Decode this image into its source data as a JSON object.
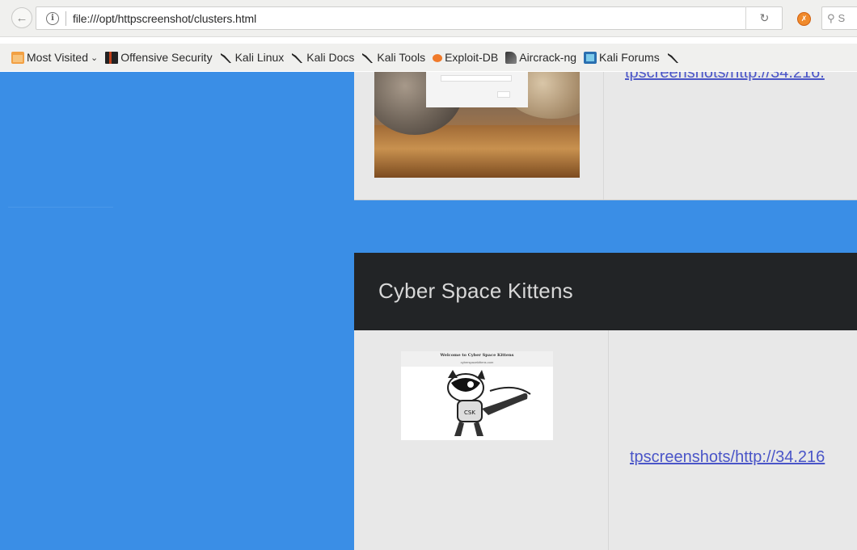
{
  "browser": {
    "url": "file:///opt/httpscreenshot/clusters.html",
    "search_placeholder": "S",
    "bookmarks": [
      {
        "label": "Most Visited",
        "icon": "folder-icon"
      },
      {
        "label": "Offensive Security",
        "icon": "offsec-icon"
      },
      {
        "label": "Kali Linux",
        "icon": "kali-dragon-icon"
      },
      {
        "label": "Kali Docs",
        "icon": "kali-dragon-icon"
      },
      {
        "label": "Kali Tools",
        "icon": "kali-dragon-icon"
      },
      {
        "label": "Exploit-DB",
        "icon": "exploit-db-icon"
      },
      {
        "label": "Aircrack-ng",
        "icon": "aircrack-icon"
      },
      {
        "label": "Kali Forums",
        "icon": "forums-icon"
      }
    ]
  },
  "cluster_1": {
    "link_text": "tpscreenshots/http://34.216."
  },
  "cluster_2": {
    "title": "Cyber Space Kittens",
    "screenshot_title": "Welcome to Cyber Space Kittens",
    "screenshot_subtitle": "cyberspacekittens.com",
    "link_text": "tpscreenshots/http://34.216"
  },
  "colors": {
    "page_background": "#3a8ee6",
    "card_header": "#222426",
    "card_body": "#e8e8e8",
    "link": "#4a55c8"
  }
}
